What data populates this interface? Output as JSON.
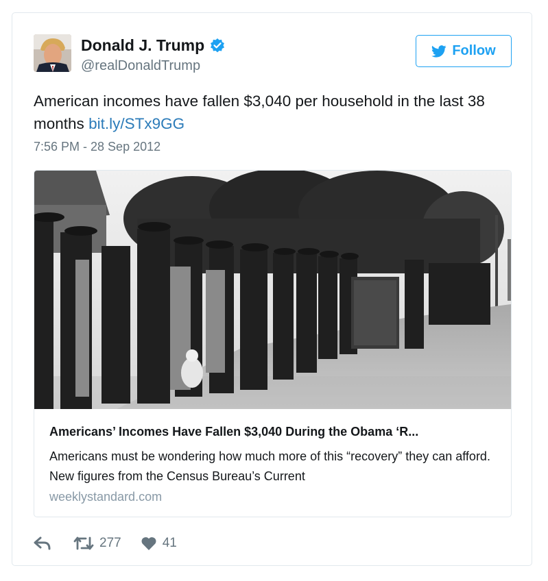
{
  "user": {
    "display_name": "Donald J. Trump",
    "handle": "@realDonaldTrump",
    "verified": true
  },
  "follow_button": {
    "label": "Follow"
  },
  "tweet": {
    "text": "American incomes have fallen $3,040 per household in the last 38 months",
    "link": "bit.ly/STx9GG",
    "timestamp": "7:56 PM - 28 Sep 2012"
  },
  "card": {
    "title": "Americans’ Incomes Have Fallen $3,040 During the Obama ‘R...",
    "description": "Americans must be wondering how much more of this “recovery” they can afford.  New figures from the Census Bureau’s Current",
    "domain": "weeklystandard.com"
  },
  "actions": {
    "reply_icon": "reply-icon",
    "retweet_icon": "retweet-icon",
    "like_icon": "heart-icon",
    "retweet_count": "277",
    "like_count": "41"
  },
  "colors": {
    "accent": "#1da1f2",
    "link": "#2b7bb9",
    "secondary_text": "#66757f",
    "border": "#e1e8ed"
  }
}
